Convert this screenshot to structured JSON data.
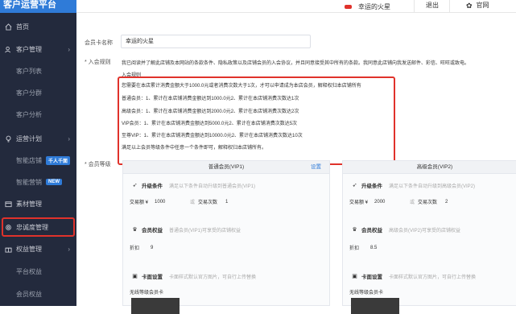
{
  "app": {
    "logo_text": "客户运营平台"
  },
  "topbar": {
    "store_name": "幸运的火星",
    "logout": "退出",
    "official_site": "官网"
  },
  "sidebar": {
    "items": [
      {
        "label": "首页",
        "icon": "home-icon"
      },
      {
        "label": "客户管理",
        "icon": "users-icon"
      },
      {
        "label": "客户列表"
      },
      {
        "label": "客户分群"
      },
      {
        "label": "客户分析"
      },
      {
        "label": "运营计划",
        "icon": "lightbulb-icon"
      },
      {
        "label": "智能店铺",
        "badge": "千人千面"
      },
      {
        "label": "智能营销",
        "badge": "NEW"
      },
      {
        "label": "素材管理",
        "icon": "folder-icon"
      },
      {
        "label": "忠诚度管理",
        "icon": "gear-icon"
      },
      {
        "label": "权益管理",
        "icon": "gift-icon"
      },
      {
        "label": "平台权益"
      },
      {
        "label": "会员权益"
      }
    ]
  },
  "form": {
    "card_name_label": "会员卡名称",
    "card_name_value": "幸运的火星",
    "join_rule_label": "入会规则",
    "agreement_text": "我已阅读并了解此店铺及本网站的条款条件、隐私政策以及店铺会员的入会协议，并且同意接受其中所有的条款。我同意此店铺向我发送邮件、彩信、旺旺或致电。",
    "join_rule_title": "入会规则",
    "rules": [
      "您需要在本店累计消费金额大于1000.0元或者消费次数大于1次，才可以申请成为本店会员，解释权归本店铺所有",
      "普通会员：1、累计在本店铺消费金额达到1000.0元2、累计在本店铺消费次数达1次",
      "高级会员：1、累计在本店铺消费金额达到2000.0元2、累计在本店铺消费次数达2次",
      "VIP会员：1、累计在本店铺消费金额达到5000.0元2、累计在本店铺消费次数达5次",
      "至尊VIP：1、累计在本店铺消费金额达到10000.0元2、累计在本店铺消费次数达10次",
      "满足以上会员等级条件中任意一个条件即可，解释权归本店铺所有。"
    ],
    "level_label": "会员等级"
  },
  "cards": [
    {
      "title": "普通会员(VIP1)",
      "settings": "设置",
      "upgrade_label": "升级条件",
      "upgrade_placeholder": "满足以下条件自动升级到普通会员(VIP1)",
      "amount_label": "交易额 ¥",
      "amount_value": "1000",
      "or_text": "或",
      "count_label": "交易次数",
      "count_value": "1",
      "benefit_label": "会员权益",
      "benefit_placeholder": "普通会员(VIP1)可享受的店铺权益",
      "discount_label": "折扣",
      "discount_value": "9",
      "face_label": "卡面设置",
      "face_placeholder": "卡面样式默认官方图片，可自行上传替换",
      "face_text": "无线等级会员卡"
    },
    {
      "title": "高级会员(VIP2)",
      "upgrade_label": "升级条件",
      "upgrade_placeholder": "满足以下条件自动升级到高级会员(VIP2)",
      "amount_label": "交易额 ¥",
      "amount_value": "2000",
      "or_text": "或",
      "count_label": "交易次数",
      "count_value": "2",
      "benefit_label": "会员权益",
      "benefit_placeholder": "高级会员(VIP2)可享受的店铺权益",
      "discount_label": "折扣",
      "discount_value": "8.5",
      "face_label": "卡面设置",
      "face_placeholder": "卡面样式默认官方图片，可自行上传替换",
      "face_text": "无线等级会员卡"
    }
  ],
  "colors": {
    "sidebar_bg": "#232a3d",
    "accent": "#2f7bd8",
    "highlight": "#e0322b"
  }
}
